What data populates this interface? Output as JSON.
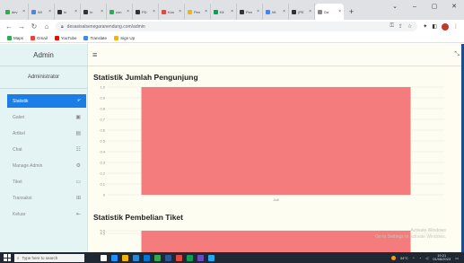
{
  "browser": {
    "tabs": [
      {
        "label": "dev",
        "color": "#34a853"
      },
      {
        "label": "Wi",
        "color": "#4285f4"
      },
      {
        "label": "In",
        "color": "#333333"
      },
      {
        "label": "In",
        "color": "#333333"
      },
      {
        "label": "con",
        "color": "#34a853"
      },
      {
        "label": "PD",
        "color": "#333333"
      },
      {
        "label": "Kon",
        "color": "#e8453c"
      },
      {
        "label": "Pen",
        "color": "#f4b400"
      },
      {
        "label": "Kli",
        "color": "#0f9d58"
      },
      {
        "label": "Pen",
        "color": "#333333"
      },
      {
        "label": "htt",
        "color": "#4285f4"
      },
      {
        "label": "(PE",
        "color": "#333333"
      },
      {
        "label": "Da",
        "color": "#888888"
      }
    ],
    "active_tab_index": 12,
    "url": "desasisalsenegaranendung.com/admin",
    "bookmarks": [
      {
        "label": "Maps",
        "color": "#34a853"
      },
      {
        "label": "Gmail",
        "color": "#ea4335"
      },
      {
        "label": "YouTube",
        "color": "#ff0000"
      },
      {
        "label": "Translate",
        "color": "#4285f4"
      },
      {
        "label": "Sign Up",
        "color": "#f4b400"
      }
    ]
  },
  "sidebar": {
    "brand": "Admin",
    "user": "Administrator",
    "items": [
      {
        "label": "Statistik",
        "icon": "chart-icon",
        "glyph": "⩗",
        "active": true
      },
      {
        "label": "Galeri",
        "icon": "image-icon",
        "glyph": "▣",
        "active": false
      },
      {
        "label": "Artikel",
        "icon": "document-icon",
        "glyph": "▤",
        "active": false
      },
      {
        "label": "Chat",
        "icon": "chat-icon",
        "glyph": "☷",
        "active": false
      },
      {
        "label": "Manage Admin",
        "icon": "gear-icon",
        "glyph": "⚙",
        "active": false
      },
      {
        "label": "Tiket",
        "icon": "ticket-icon",
        "glyph": "▭",
        "active": false
      },
      {
        "label": "Transaksi",
        "icon": "transaction-icon",
        "glyph": "⊞",
        "active": false
      },
      {
        "label": "Keluar",
        "icon": "logout-icon",
        "glyph": "⇤",
        "active": false
      }
    ]
  },
  "main": {
    "chart1_title": "Statistik Jumlah Pengunjung",
    "chart2_title": "Statistik Pembelian Tiket",
    "watermark_line1": "Activate Windows",
    "watermark_line2": "Go to Settings to activate Windows."
  },
  "chart_data": [
    {
      "type": "bar",
      "title": "Statistik Jumlah Pengunjung",
      "categories": [
        "Juli"
      ],
      "values": [
        1.0
      ],
      "ylim": [
        0,
        1.0
      ],
      "yticks": [
        "0",
        "0.1",
        "0.2",
        "0.3",
        "0.4",
        "0.5",
        "0.6",
        "0.7",
        "0.8",
        "0.9",
        "1.0"
      ],
      "bar_color": "#f47c7c",
      "grid": true
    },
    {
      "type": "bar",
      "title": "Statistik Pembelian Tiket",
      "categories": [
        ""
      ],
      "values": [
        5.0
      ],
      "ylim": [
        0,
        5.0
      ],
      "yticks": [
        "4.5",
        "5.0"
      ],
      "bar_color": "#f47c7c",
      "grid": true
    }
  ],
  "taskbar": {
    "search_placeholder": "Type here to search",
    "weather": "34°C",
    "time": "19:21",
    "date": "01/08/2023"
  }
}
